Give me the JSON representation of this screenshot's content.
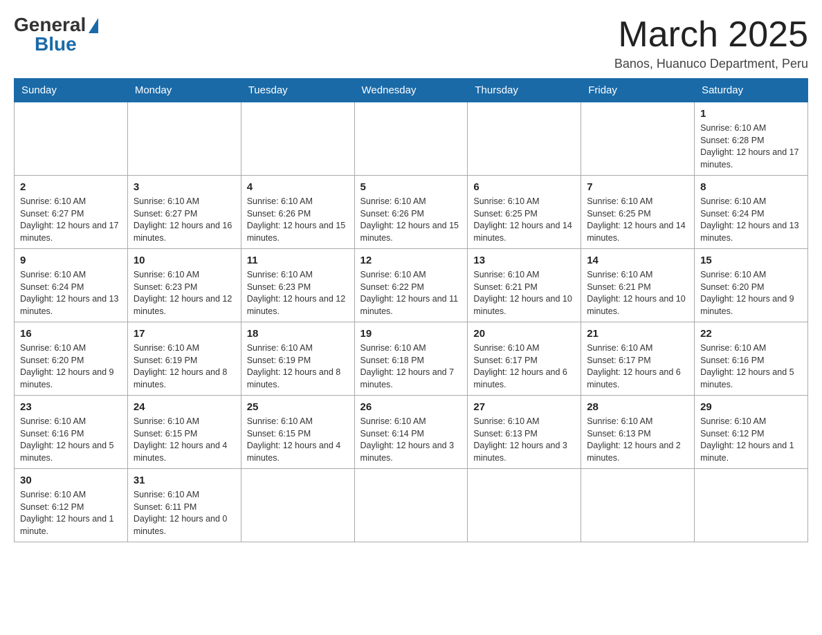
{
  "logo": {
    "general": "General",
    "blue": "Blue"
  },
  "header": {
    "month": "March 2025",
    "location": "Banos, Huanuco Department, Peru"
  },
  "weekdays": [
    "Sunday",
    "Monday",
    "Tuesday",
    "Wednesday",
    "Thursday",
    "Friday",
    "Saturday"
  ],
  "weeks": [
    [
      {
        "day": "",
        "info": ""
      },
      {
        "day": "",
        "info": ""
      },
      {
        "day": "",
        "info": ""
      },
      {
        "day": "",
        "info": ""
      },
      {
        "day": "",
        "info": ""
      },
      {
        "day": "",
        "info": ""
      },
      {
        "day": "1",
        "info": "Sunrise: 6:10 AM\nSunset: 6:28 PM\nDaylight: 12 hours and 17 minutes."
      }
    ],
    [
      {
        "day": "2",
        "info": "Sunrise: 6:10 AM\nSunset: 6:27 PM\nDaylight: 12 hours and 17 minutes."
      },
      {
        "day": "3",
        "info": "Sunrise: 6:10 AM\nSunset: 6:27 PM\nDaylight: 12 hours and 16 minutes."
      },
      {
        "day": "4",
        "info": "Sunrise: 6:10 AM\nSunset: 6:26 PM\nDaylight: 12 hours and 15 minutes."
      },
      {
        "day": "5",
        "info": "Sunrise: 6:10 AM\nSunset: 6:26 PM\nDaylight: 12 hours and 15 minutes."
      },
      {
        "day": "6",
        "info": "Sunrise: 6:10 AM\nSunset: 6:25 PM\nDaylight: 12 hours and 14 minutes."
      },
      {
        "day": "7",
        "info": "Sunrise: 6:10 AM\nSunset: 6:25 PM\nDaylight: 12 hours and 14 minutes."
      },
      {
        "day": "8",
        "info": "Sunrise: 6:10 AM\nSunset: 6:24 PM\nDaylight: 12 hours and 13 minutes."
      }
    ],
    [
      {
        "day": "9",
        "info": "Sunrise: 6:10 AM\nSunset: 6:24 PM\nDaylight: 12 hours and 13 minutes."
      },
      {
        "day": "10",
        "info": "Sunrise: 6:10 AM\nSunset: 6:23 PM\nDaylight: 12 hours and 12 minutes."
      },
      {
        "day": "11",
        "info": "Sunrise: 6:10 AM\nSunset: 6:23 PM\nDaylight: 12 hours and 12 minutes."
      },
      {
        "day": "12",
        "info": "Sunrise: 6:10 AM\nSunset: 6:22 PM\nDaylight: 12 hours and 11 minutes."
      },
      {
        "day": "13",
        "info": "Sunrise: 6:10 AM\nSunset: 6:21 PM\nDaylight: 12 hours and 10 minutes."
      },
      {
        "day": "14",
        "info": "Sunrise: 6:10 AM\nSunset: 6:21 PM\nDaylight: 12 hours and 10 minutes."
      },
      {
        "day": "15",
        "info": "Sunrise: 6:10 AM\nSunset: 6:20 PM\nDaylight: 12 hours and 9 minutes."
      }
    ],
    [
      {
        "day": "16",
        "info": "Sunrise: 6:10 AM\nSunset: 6:20 PM\nDaylight: 12 hours and 9 minutes."
      },
      {
        "day": "17",
        "info": "Sunrise: 6:10 AM\nSunset: 6:19 PM\nDaylight: 12 hours and 8 minutes."
      },
      {
        "day": "18",
        "info": "Sunrise: 6:10 AM\nSunset: 6:19 PM\nDaylight: 12 hours and 8 minutes."
      },
      {
        "day": "19",
        "info": "Sunrise: 6:10 AM\nSunset: 6:18 PM\nDaylight: 12 hours and 7 minutes."
      },
      {
        "day": "20",
        "info": "Sunrise: 6:10 AM\nSunset: 6:17 PM\nDaylight: 12 hours and 6 minutes."
      },
      {
        "day": "21",
        "info": "Sunrise: 6:10 AM\nSunset: 6:17 PM\nDaylight: 12 hours and 6 minutes."
      },
      {
        "day": "22",
        "info": "Sunrise: 6:10 AM\nSunset: 6:16 PM\nDaylight: 12 hours and 5 minutes."
      }
    ],
    [
      {
        "day": "23",
        "info": "Sunrise: 6:10 AM\nSunset: 6:16 PM\nDaylight: 12 hours and 5 minutes."
      },
      {
        "day": "24",
        "info": "Sunrise: 6:10 AM\nSunset: 6:15 PM\nDaylight: 12 hours and 4 minutes."
      },
      {
        "day": "25",
        "info": "Sunrise: 6:10 AM\nSunset: 6:15 PM\nDaylight: 12 hours and 4 minutes."
      },
      {
        "day": "26",
        "info": "Sunrise: 6:10 AM\nSunset: 6:14 PM\nDaylight: 12 hours and 3 minutes."
      },
      {
        "day": "27",
        "info": "Sunrise: 6:10 AM\nSunset: 6:13 PM\nDaylight: 12 hours and 3 minutes."
      },
      {
        "day": "28",
        "info": "Sunrise: 6:10 AM\nSunset: 6:13 PM\nDaylight: 12 hours and 2 minutes."
      },
      {
        "day": "29",
        "info": "Sunrise: 6:10 AM\nSunset: 6:12 PM\nDaylight: 12 hours and 1 minute."
      }
    ],
    [
      {
        "day": "30",
        "info": "Sunrise: 6:10 AM\nSunset: 6:12 PM\nDaylight: 12 hours and 1 minute."
      },
      {
        "day": "31",
        "info": "Sunrise: 6:10 AM\nSunset: 6:11 PM\nDaylight: 12 hours and 0 minutes."
      },
      {
        "day": "",
        "info": ""
      },
      {
        "day": "",
        "info": ""
      },
      {
        "day": "",
        "info": ""
      },
      {
        "day": "",
        "info": ""
      },
      {
        "day": "",
        "info": ""
      }
    ]
  ]
}
